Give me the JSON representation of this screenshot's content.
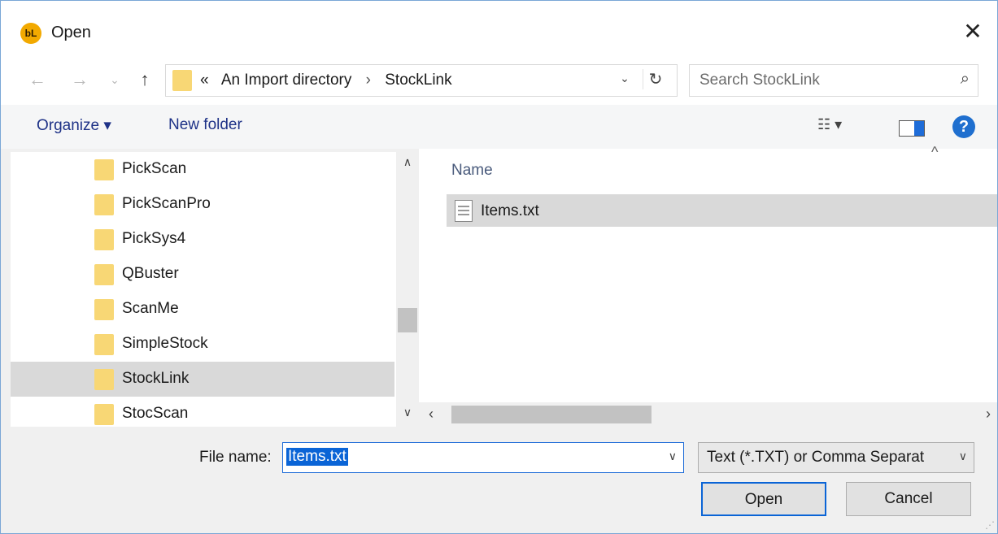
{
  "window": {
    "title": "Open",
    "app_icon_text": "bL",
    "close_glyph": "✕"
  },
  "address": {
    "overflow": "«",
    "crumbs": [
      "An Import directory",
      "StockLink"
    ],
    "separator": "›"
  },
  "search": {
    "placeholder": "Search StockLink"
  },
  "toolbar": {
    "organize_label": "Organize ▾",
    "new_folder_label": "New folder",
    "help_glyph": "?"
  },
  "nav_folders": [
    {
      "label": "PickScan",
      "selected": false
    },
    {
      "label": "PickScanPro",
      "selected": false
    },
    {
      "label": "PickSys4",
      "selected": false
    },
    {
      "label": "QBuster",
      "selected": false
    },
    {
      "label": "ScanMe",
      "selected": false
    },
    {
      "label": "SimpleStock",
      "selected": false
    },
    {
      "label": "StockLink",
      "selected": true
    },
    {
      "label": "StocScan",
      "selected": false
    }
  ],
  "file_list": {
    "column_name": "Name",
    "files": [
      {
        "name": "Items.txt"
      }
    ]
  },
  "bottom": {
    "file_name_label": "File name:",
    "file_name_value": "Items.txt",
    "file_type_value": "Text (*.TXT) or Comma Separat",
    "open_label": "Open",
    "cancel_label": "Cancel"
  },
  "colors": {
    "accent": "#0a64d6",
    "folder": "#f8d775",
    "selection": "#d9d9d9",
    "app_icon": "#f2a900"
  }
}
